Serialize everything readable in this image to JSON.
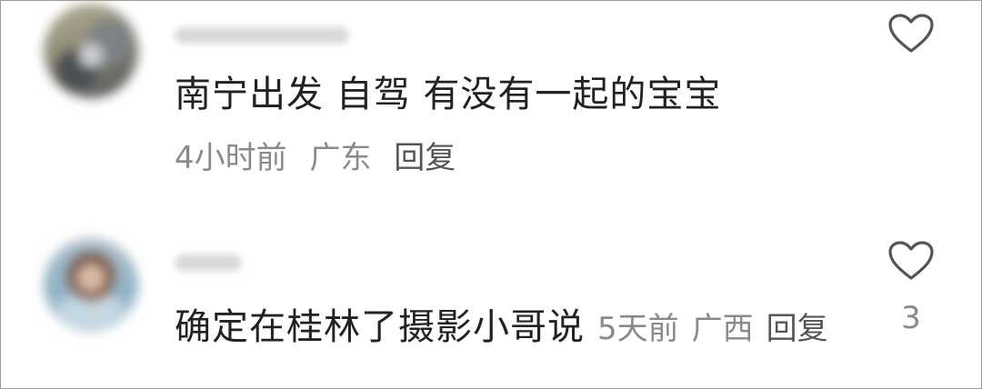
{
  "comments": [
    {
      "icon": "heart-outline-icon",
      "content": "南宁出发 自驾 有没有一起的宝宝",
      "time": "4小时前",
      "location": "广东",
      "reply_label": "回复",
      "like_count": ""
    },
    {
      "icon": "heart-outline-icon",
      "content": "确定在桂林了摄影小哥说",
      "time": "5天前",
      "location": "广西",
      "reply_label": "回复",
      "like_count": "3"
    }
  ],
  "colors": {
    "text": "#222222",
    "meta": "#8a8a8a",
    "icon": "#555555"
  }
}
